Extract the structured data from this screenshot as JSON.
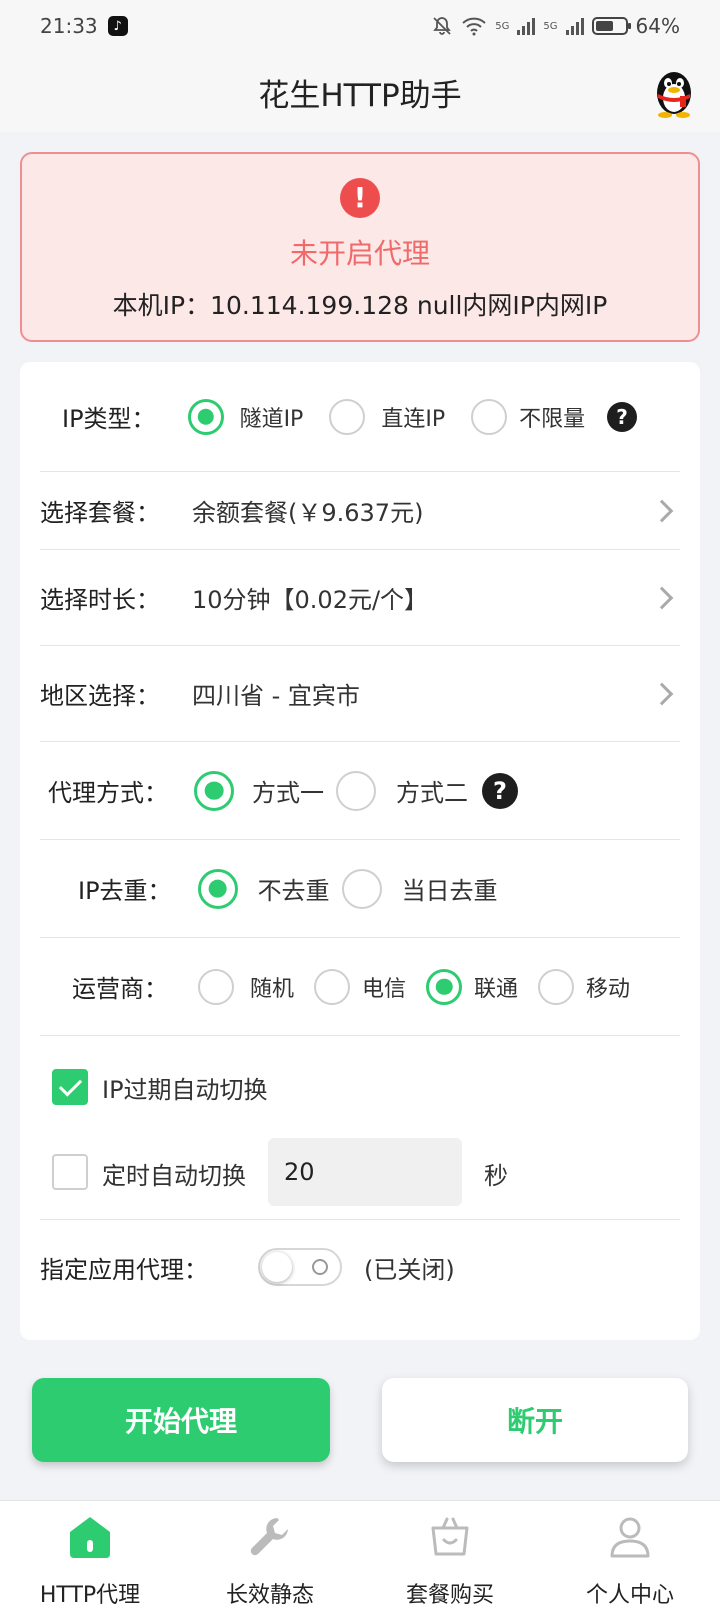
{
  "status_bar": {
    "time": "21:33",
    "battery": "64%",
    "battery_level": 0.64,
    "net1": "5G",
    "net2": "5G"
  },
  "header": {
    "title": "花生HTTP助手",
    "avatar_icon": "qq-penguin-icon"
  },
  "alert": {
    "icon": "!",
    "title": "未开启代理",
    "ip_text": "本机IP：10.114.199.128  null内网IP内网IP"
  },
  "form": {
    "ip_type": {
      "label": "IP类型：",
      "options": [
        "隧道IP",
        "直连IP",
        "不限量"
      ],
      "selected": "隧道IP",
      "help": "?"
    },
    "package": {
      "label": "选择套餐：",
      "value": "余额套餐(￥9.637元)"
    },
    "duration": {
      "label": "选择时长：",
      "value": "10分钟【0.02元/个】"
    },
    "region": {
      "label": "地区选择：",
      "value": "四川省 - 宜宾市"
    },
    "proxy_mode": {
      "label": "代理方式：",
      "options": [
        "方式一",
        "方式二"
      ],
      "selected": "方式一",
      "help": "?"
    },
    "dedup": {
      "label": "IP去重：",
      "options": [
        "不去重",
        "当日去重"
      ],
      "selected": "不去重"
    },
    "carrier": {
      "label": "运营商：",
      "options": [
        "随机",
        "电信",
        "联通",
        "移动"
      ],
      "selected": "联通"
    },
    "auto_switch_expire": {
      "label": "IP过期自动切换",
      "checked": true
    },
    "auto_switch_timer": {
      "label": "定时自动切换",
      "checked": false,
      "value": "20",
      "unit": "秒"
    },
    "app_proxy": {
      "label": "指定应用代理：",
      "state_text": "(已关闭)",
      "enabled": false
    }
  },
  "buttons": {
    "start": "开始代理",
    "stop": "断开"
  },
  "tabs": [
    {
      "label": "HTTP代理",
      "icon": "home-icon",
      "active": true
    },
    {
      "label": "长效静态",
      "icon": "wrench-icon",
      "active": false
    },
    {
      "label": "套餐购买",
      "icon": "shop-basket-icon",
      "active": false
    },
    {
      "label": "个人中心",
      "icon": "user-icon",
      "active": false
    }
  ],
  "colors": {
    "accent": "#2ecc71",
    "alert_bg": "#fde8e8",
    "alert_border": "#ee8f8f",
    "alert_text": "#ef6a6a",
    "alert_icon": "#ee4d4d"
  }
}
